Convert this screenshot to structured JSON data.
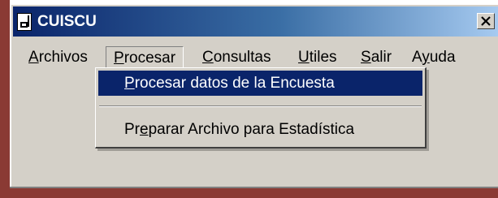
{
  "window": {
    "title": "CUISCU",
    "close_label": "X"
  },
  "menubar": {
    "items": [
      {
        "key": "archivos",
        "mnemonic": "A",
        "rest": "rchivos"
      },
      {
        "key": "procesar",
        "mnemonic": "P",
        "rest": "rocesar"
      },
      {
        "key": "consultas",
        "mnemonic": "C",
        "rest": "onsultas"
      },
      {
        "key": "utiles",
        "mnemonic": "U",
        "rest": "tiles"
      },
      {
        "key": "salir",
        "mnemonic": "S",
        "rest": "alir"
      },
      {
        "key": "ayuda",
        "pre": "A",
        "mnemonic": "y",
        "rest": "uda"
      }
    ],
    "open_menu": "Procesar"
  },
  "dropdown": {
    "items": [
      {
        "mnemonic": "P",
        "rest": "rocesar datos de la Encuesta",
        "highlighted": true
      },
      {
        "pre": "Pr",
        "mnemonic": "e",
        "rest": "parar Archivo para Estadística",
        "highlighted": false
      }
    ]
  },
  "colors": {
    "title_gradient_start": "#0a246a",
    "title_gradient_end": "#a6caf0",
    "face": "#d4d0c8",
    "highlight": "#0a246a",
    "backdrop": "#8a3a34"
  },
  "icons": {
    "app": "app-icon",
    "close": "close-icon"
  }
}
